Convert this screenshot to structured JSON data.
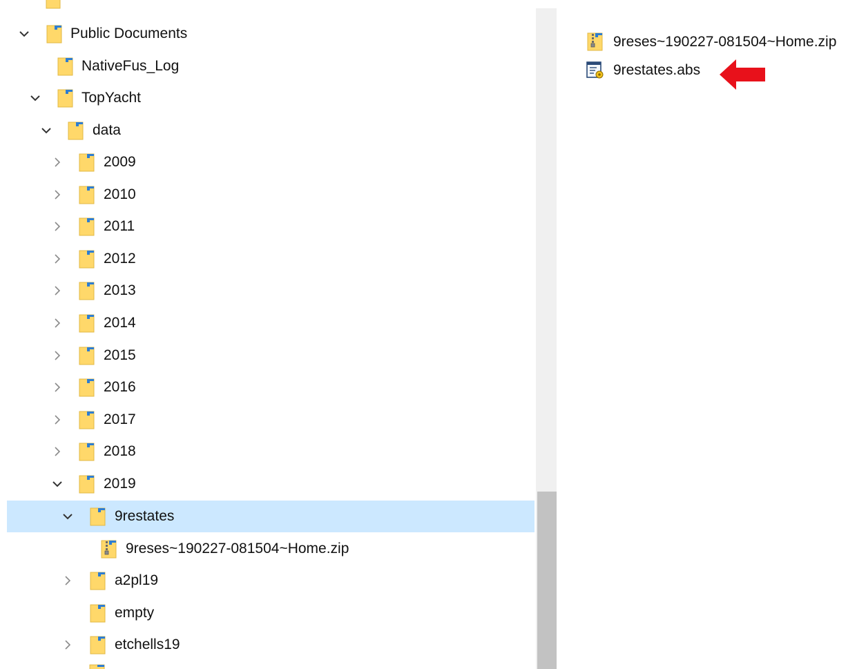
{
  "tree": {
    "items": [
      {
        "label": "Public Documents",
        "expanded": "true",
        "icon": "folder-icon"
      },
      {
        "label": "NativeFus_Log",
        "icon": "folder-icon"
      },
      {
        "label": "TopYacht",
        "expanded": "true",
        "icon": "folder-icon"
      },
      {
        "label": "data",
        "expanded": "true",
        "icon": "folder-icon"
      },
      {
        "label": "2009",
        "expanded": "false",
        "icon": "folder-icon"
      },
      {
        "label": "2010",
        "expanded": "false",
        "icon": "folder-icon"
      },
      {
        "label": "2011",
        "expanded": "false",
        "icon": "folder-icon"
      },
      {
        "label": "2012",
        "expanded": "false",
        "icon": "folder-icon"
      },
      {
        "label": "2013",
        "expanded": "false",
        "icon": "folder-icon"
      },
      {
        "label": "2014",
        "expanded": "false",
        "icon": "folder-icon"
      },
      {
        "label": "2015",
        "expanded": "false",
        "icon": "folder-icon"
      },
      {
        "label": "2016",
        "expanded": "false",
        "icon": "folder-icon"
      },
      {
        "label": "2017",
        "expanded": "false",
        "icon": "folder-icon"
      },
      {
        "label": "2018",
        "expanded": "false",
        "icon": "folder-icon"
      },
      {
        "label": "2019",
        "expanded": "true",
        "icon": "folder-icon"
      },
      {
        "label": "9restates",
        "expanded": "true",
        "selected": "true",
        "icon": "folder-icon"
      },
      {
        "label": "9reses~190227-081504~Home.zip",
        "icon": "zip-folder-icon"
      },
      {
        "label": "a2pl19",
        "expanded": "false",
        "icon": "folder-icon"
      },
      {
        "label": "empty",
        "icon": "folder-icon"
      },
      {
        "label": "etchells19",
        "expanded": "false",
        "icon": "folder-icon"
      }
    ]
  },
  "content": {
    "files": [
      {
        "label": "9reses~190227-081504~Home.zip",
        "icon": "zip-folder-icon"
      },
      {
        "label": "9restates.abs",
        "icon": "abs-file-icon"
      }
    ],
    "annotation": {
      "icon": "red-arrow-icon",
      "color": "#e8111b"
    }
  },
  "colors": {
    "selection": "#cce8ff",
    "folder": "#ffd86a",
    "scroll_thumb": "#c2c2c2"
  }
}
